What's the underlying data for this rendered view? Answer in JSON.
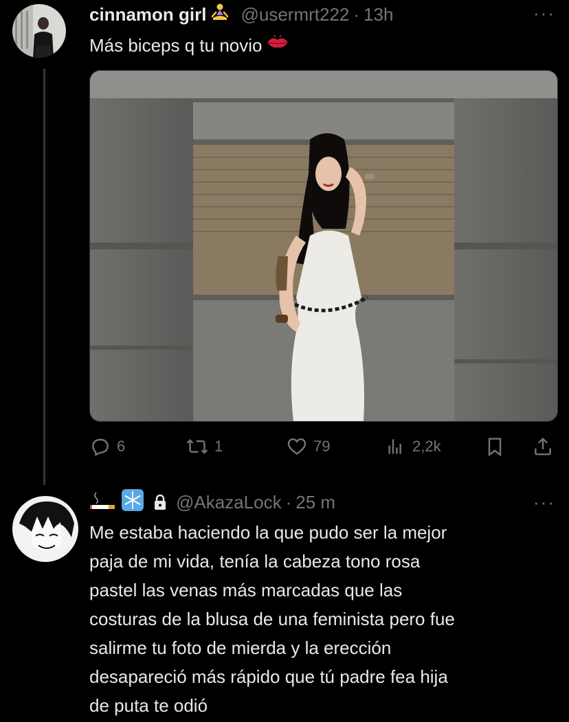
{
  "colors": {
    "background": "#000000",
    "primary_text": "#e7e9ea",
    "secondary_text": "#71767b",
    "divider": "#333639"
  },
  "tweet": {
    "author_name": "cinnamon girl",
    "author_emoji": "person-in-lotus-position-emoji",
    "handle": "@usermrt222",
    "separator": "·",
    "time": "13h",
    "more": "···",
    "text": "Más biceps q tu novio",
    "text_emoji": "kiss-mark-emoji",
    "actions": {
      "replies": "6",
      "retweets": "1",
      "likes": "79",
      "views": "2,2k"
    }
  },
  "reply": {
    "name_emojis": [
      "cigarette-emoji",
      "snowflake-emoji"
    ],
    "protected_icon": "lock-icon",
    "handle": "@AkazaLock",
    "separator": "·",
    "time": "25 m",
    "more": "···",
    "lines": [
      "Me estaba haciendo la que pudo ser la mejor",
      "paja de mi vida, tenía la cabeza tono rosa",
      "pastel las venas más marcadas que las",
      "costuras de la blusa de una feminista pero fue",
      "salirme tu foto de mierda y la erección",
      "desapareció más rápido que tú padre fea hija",
      "de puta te odió"
    ]
  }
}
